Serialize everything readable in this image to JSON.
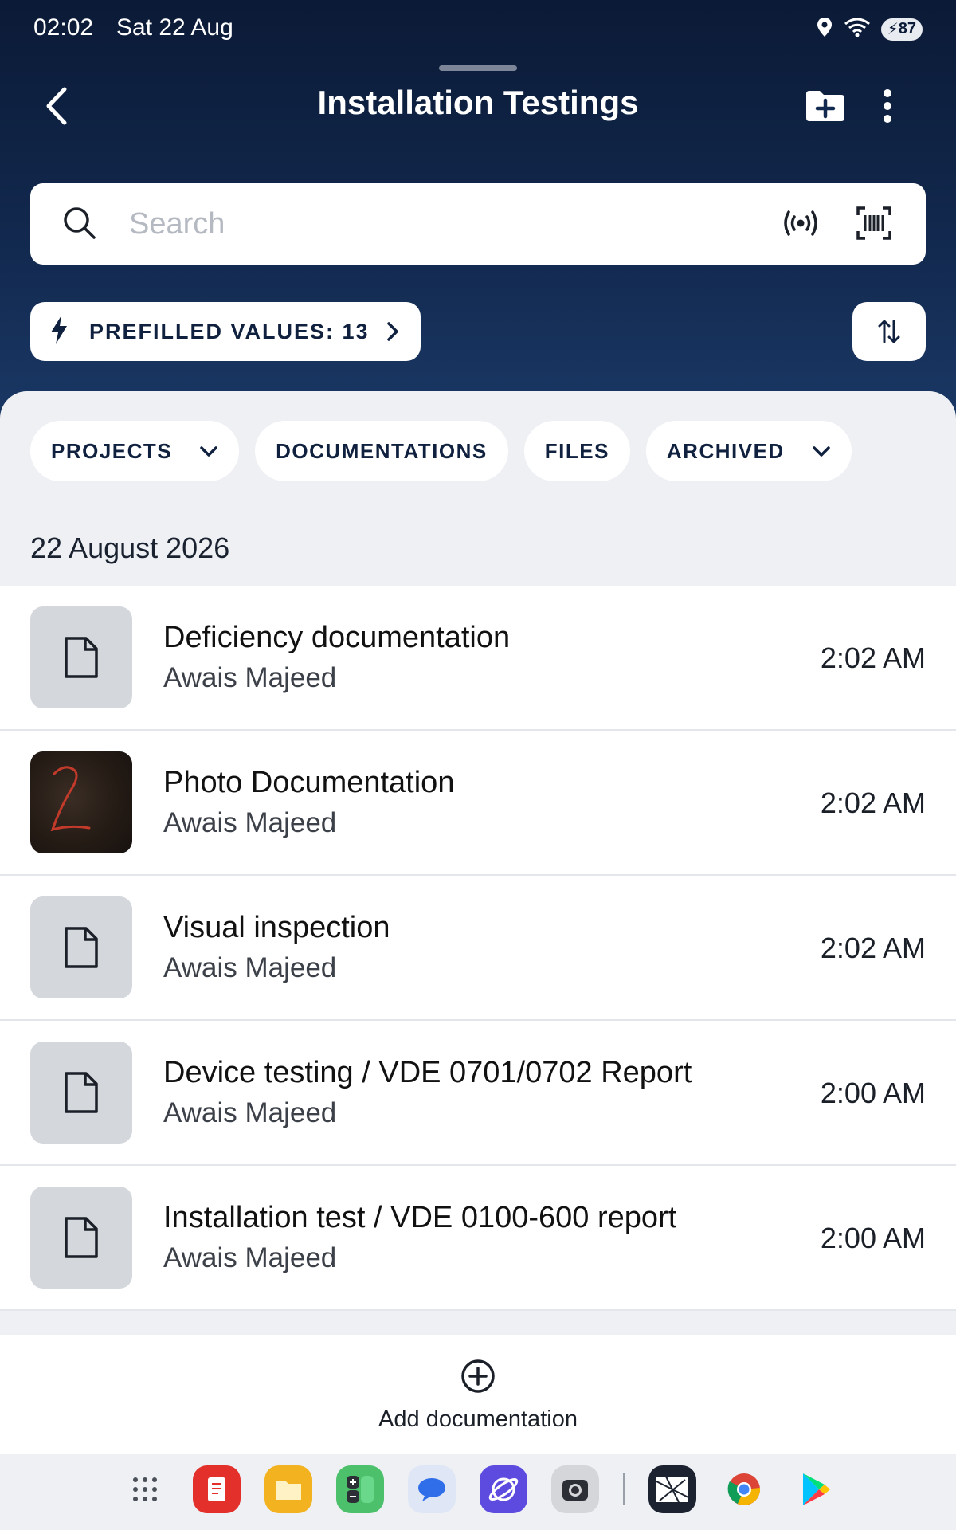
{
  "status_bar": {
    "time": "02:02",
    "date": "Sat 22 Aug",
    "battery": "87"
  },
  "app_bar": {
    "title": "Installation Testings"
  },
  "search": {
    "placeholder": "Search"
  },
  "prefilled": {
    "label": "PREFILLED VALUES: 13"
  },
  "filters": [
    {
      "label": "PROJECTS",
      "has_dropdown": true
    },
    {
      "label": "DOCUMENTATIONS",
      "has_dropdown": false
    },
    {
      "label": "FILES",
      "has_dropdown": false
    },
    {
      "label": "ARCHIVED",
      "has_dropdown": true
    }
  ],
  "date_header": "22 August 2026",
  "documents": [
    {
      "title": "Deficiency documentation",
      "author": "Awais Majeed",
      "time": "2:02 AM",
      "thumb": "file-icon"
    },
    {
      "title": "Photo Documentation",
      "author": "Awais Majeed",
      "time": "2:02 AM",
      "thumb": "photo"
    },
    {
      "title": "Visual inspection",
      "author": "Awais Majeed",
      "time": "2:02 AM",
      "thumb": "file-icon"
    },
    {
      "title": "Device testing / VDE 0701/0702 Report",
      "author": "Awais Majeed",
      "time": "2:00 AM",
      "thumb": "file-icon"
    },
    {
      "title": "Installation test / VDE 0100-600 report",
      "author": "Awais Majeed",
      "time": "2:00 AM",
      "thumb": "file-icon"
    }
  ],
  "add_documentation": {
    "label": "Add documentation"
  },
  "dock_apps": [
    "app-drawer-icon",
    "notes-app-icon",
    "files-app-icon",
    "calculator-app-icon",
    "messages-app-icon",
    "internet-app-icon",
    "camera-app-icon",
    "app-icon",
    "chrome-app-icon",
    "play-store-app-icon"
  ],
  "colors": {
    "header_dark": "#0b1a36",
    "header_light": "#1b3a68",
    "background": "#eef0f4",
    "text_dark": "#10213f"
  }
}
